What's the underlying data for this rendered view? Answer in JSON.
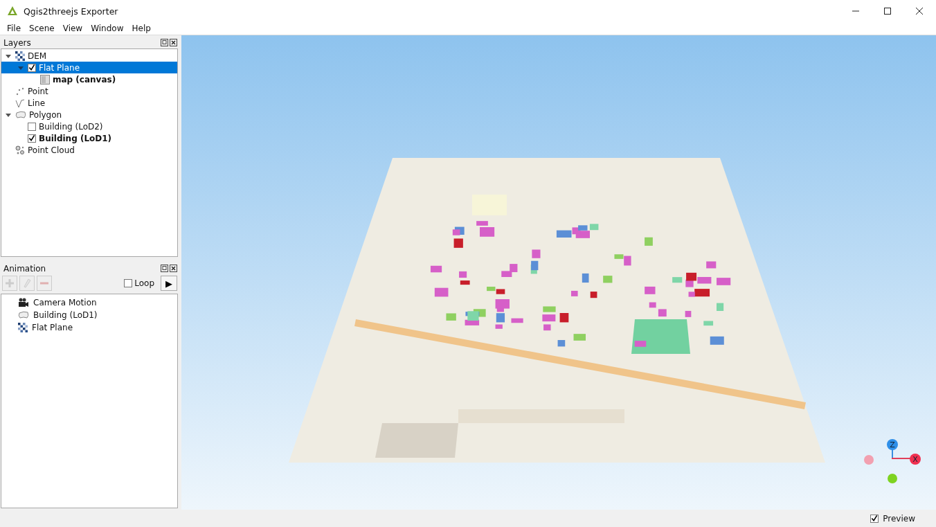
{
  "window": {
    "title": "Qgis2threejs Exporter"
  },
  "menu": [
    "File",
    "Scene",
    "View",
    "Window",
    "Help"
  ],
  "layers_panel": {
    "title": "Layers",
    "items": [
      {
        "label": "DEM",
        "kind": "dem",
        "expanded": true,
        "selected": false,
        "bold": false,
        "children": [
          {
            "label": "Flat Plane",
            "checked": true,
            "expanded": true,
            "selected": true,
            "bold": false,
            "children": [
              {
                "label": "map (canvas)",
                "kind": "map",
                "selected": false,
                "bold": true
              }
            ]
          }
        ]
      },
      {
        "label": "Point",
        "kind": "point",
        "selected": false,
        "bold": false
      },
      {
        "label": "Line",
        "kind": "line",
        "selected": false,
        "bold": false
      },
      {
        "label": "Polygon",
        "kind": "polygon",
        "expanded": true,
        "selected": false,
        "bold": false,
        "children": [
          {
            "label": "Building (LoD2)",
            "checked": false,
            "selected": false,
            "bold": false
          },
          {
            "label": "Building (LoD1)",
            "checked": true,
            "selected": false,
            "bold": true
          }
        ]
      },
      {
        "label": "Point Cloud",
        "kind": "pointcloud",
        "selected": false,
        "bold": false
      }
    ]
  },
  "animation_panel": {
    "title": "Animation",
    "loop": {
      "label": "Loop",
      "checked": false
    },
    "play": "▶",
    "items": [
      {
        "label": "Camera Motion",
        "kind": "camera"
      },
      {
        "label": "Building (LoD1)",
        "kind": "polygon"
      },
      {
        "label": "Flat Plane",
        "kind": "dem"
      }
    ]
  },
  "viewer": {
    "axes": {
      "z": "Z",
      "x": "X"
    }
  },
  "status_bar": {
    "preview": {
      "label": "Preview",
      "checked": true
    }
  }
}
